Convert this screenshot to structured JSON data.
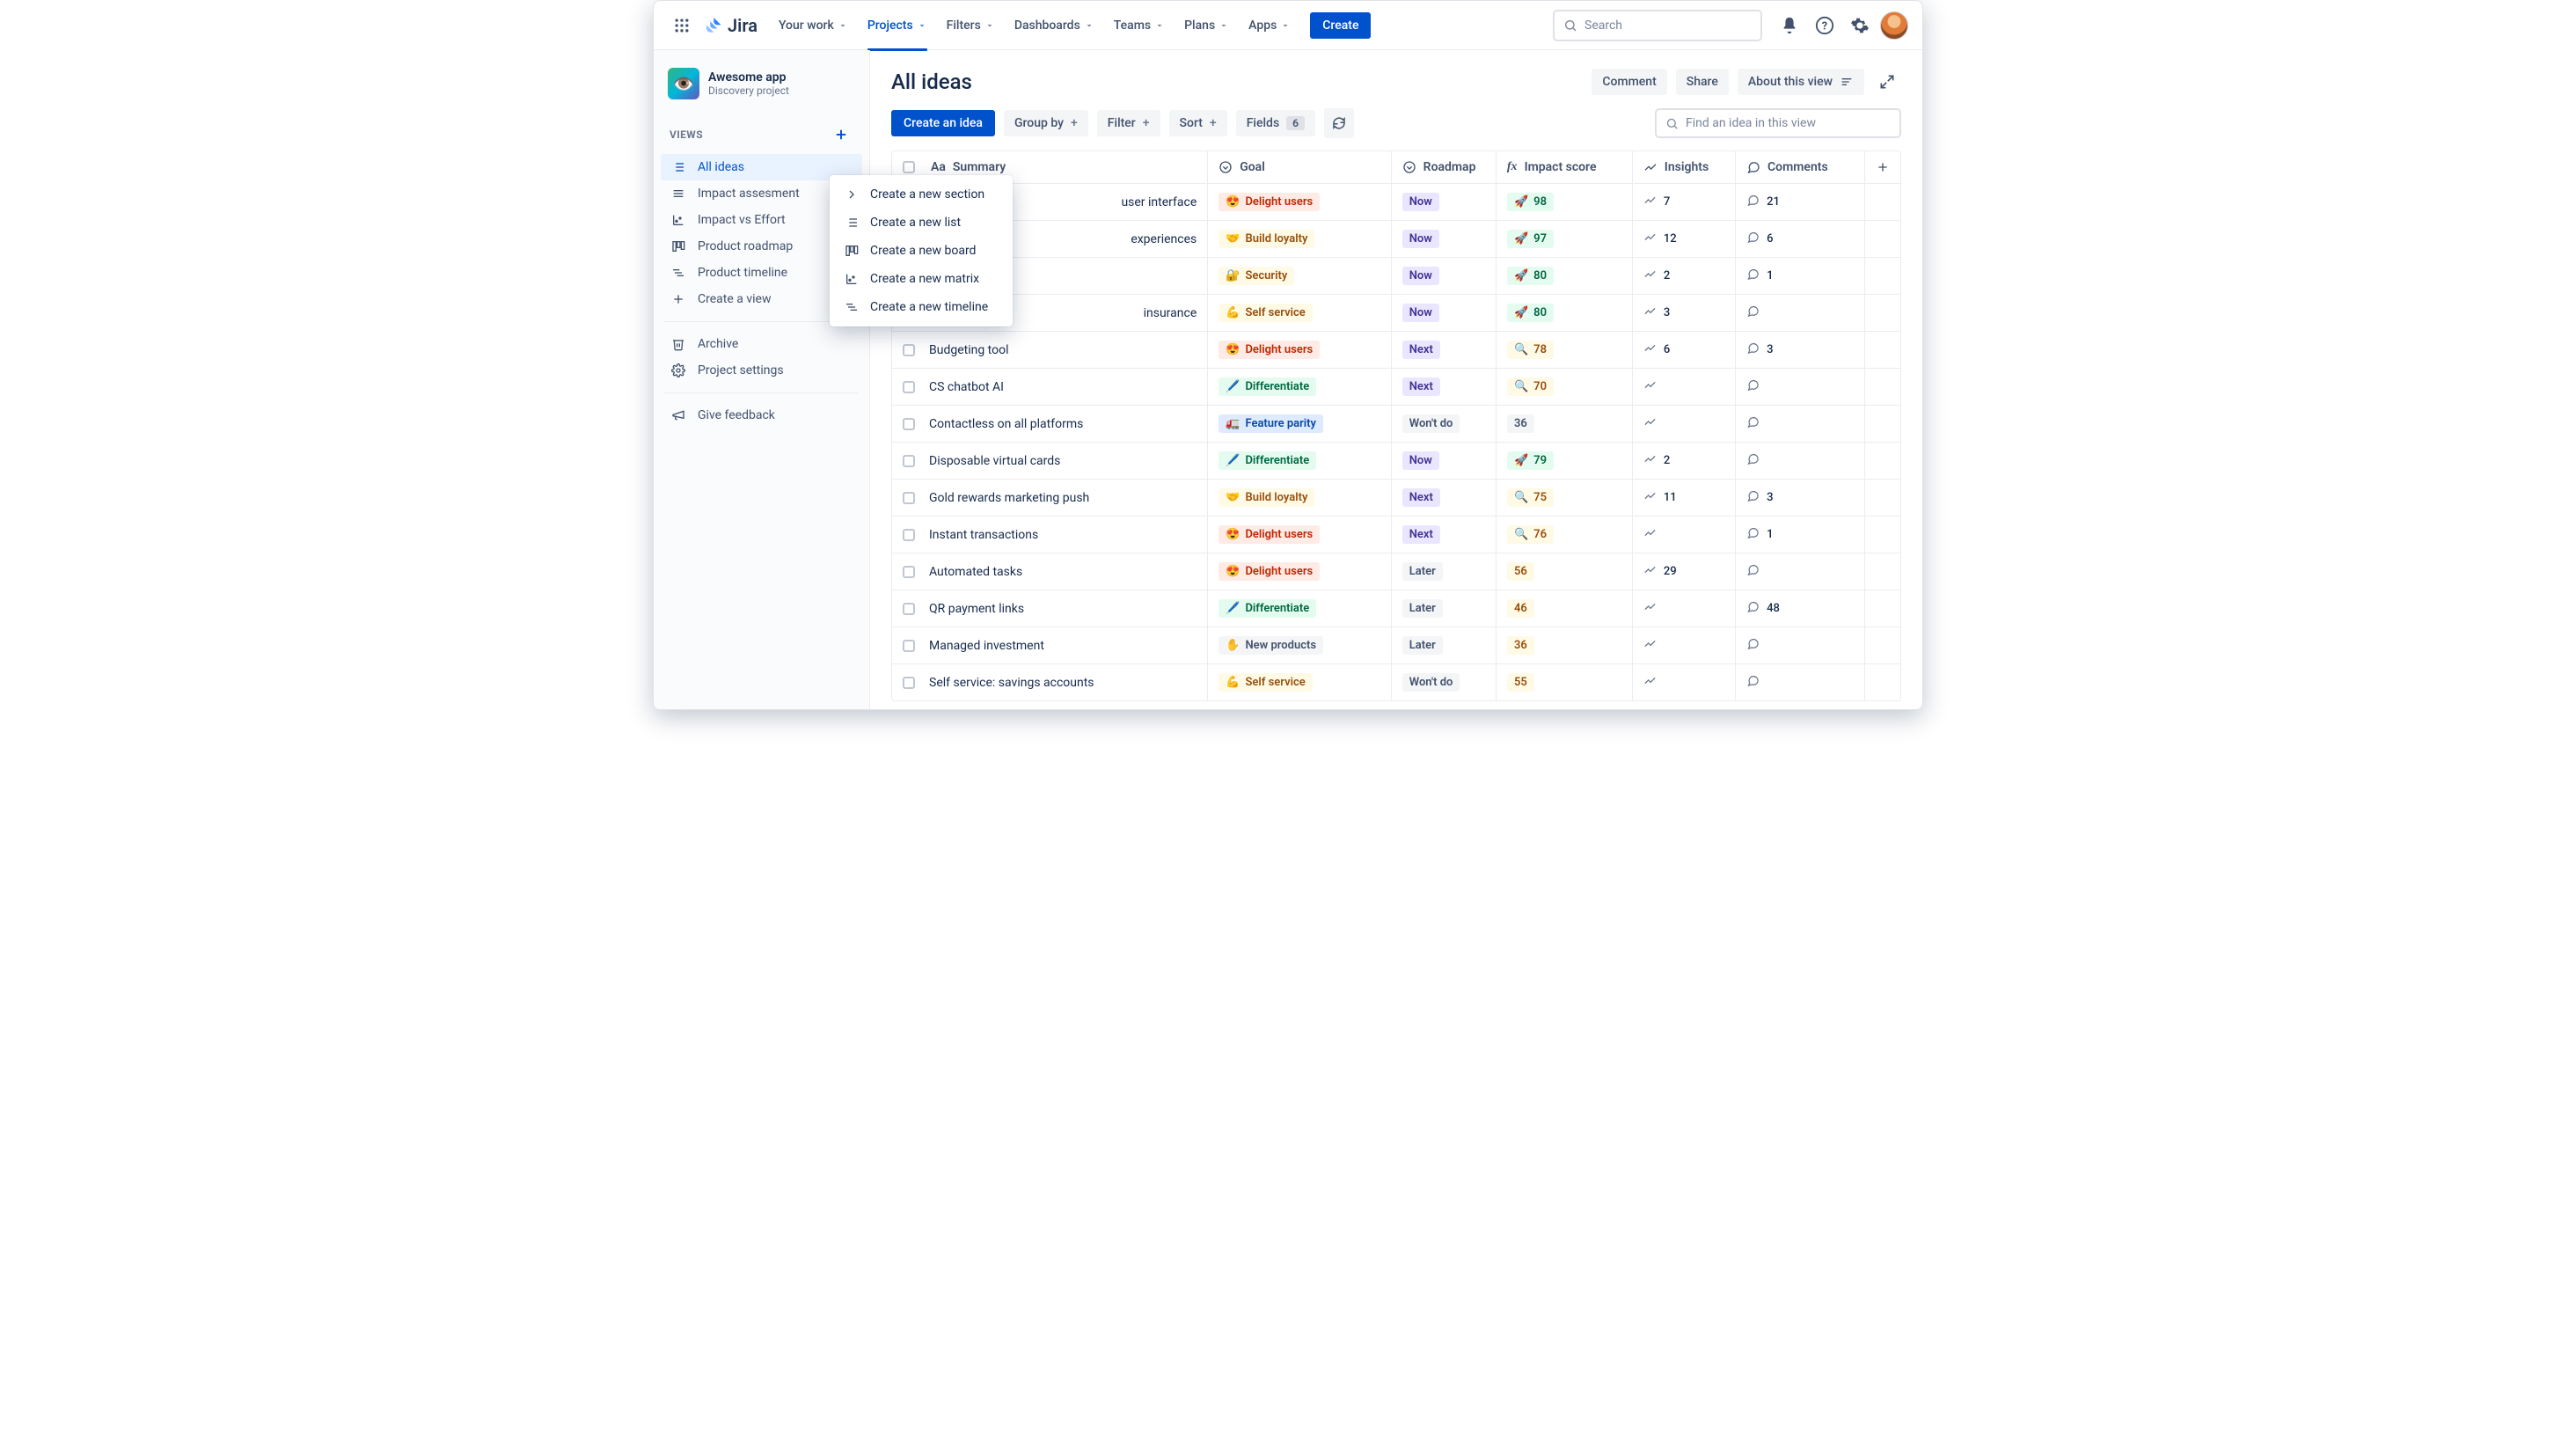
{
  "topnav": {
    "logo": "Jira",
    "items": [
      "Your work",
      "Projects",
      "Filters",
      "Dashboards",
      "Teams",
      "Plans",
      "Apps"
    ],
    "selected_index": 1,
    "create": "Create",
    "search_placeholder": "Search"
  },
  "project": {
    "name": "Awesome app",
    "subtitle": "Discovery project"
  },
  "sidebar": {
    "views_label": "VIEWS",
    "items": [
      {
        "label": "All ideas",
        "icon": "list"
      },
      {
        "label": "Impact assesment",
        "icon": "list2"
      },
      {
        "label": "Impact vs Effort",
        "icon": "matrix"
      },
      {
        "label": "Product roadmap",
        "icon": "board"
      },
      {
        "label": "Product timeline",
        "icon": "timeline"
      }
    ],
    "create_view": "Create a view",
    "archive": "Archive",
    "settings": "Project settings",
    "feedback": "Give feedback"
  },
  "context_menu": [
    {
      "label": "Create a new section",
      "icon": "chevron"
    },
    {
      "label": "Create a new list",
      "icon": "list"
    },
    {
      "label": "Create a new board",
      "icon": "board"
    },
    {
      "label": "Create a new matrix",
      "icon": "matrix"
    },
    {
      "label": "Create a new timeline",
      "icon": "timeline"
    }
  ],
  "page": {
    "title": "All ideas",
    "actions": {
      "comment": "Comment",
      "share": "Share",
      "about": "About this view"
    }
  },
  "toolbar": {
    "create_idea": "Create an idea",
    "group_by": "Group by",
    "filter": "Filter",
    "sort": "Sort",
    "fields": "Fields",
    "fields_count": "6",
    "find_placeholder": "Find an idea in this view"
  },
  "columns": {
    "summary": "Summary",
    "goal": "Goal",
    "roadmap": "Roadmap",
    "impact": "Impact score",
    "insights": "Insights",
    "comments": "Comments"
  },
  "goal_styles": {
    "Delight users": {
      "cls": "goal-delight",
      "emoji": "😍"
    },
    "Build loyalty": {
      "cls": "goal-loyalty",
      "emoji": "🤝"
    },
    "Security": {
      "cls": "goal-security",
      "emoji": "🔐"
    },
    "Self service": {
      "cls": "goal-selfservice",
      "emoji": "💪"
    },
    "Differentiate": {
      "cls": "goal-differentiate",
      "emoji": "🖊️"
    },
    "Feature parity": {
      "cls": "goal-parity",
      "emoji": "🚛"
    },
    "New products": {
      "cls": "goal-newproducts",
      "emoji": "✋"
    }
  },
  "roadmap_styles": {
    "Now": "roadmap-now",
    "Next": "roadmap-next",
    "Later": "roadmap-later",
    "Won't do": "roadmap-wont"
  },
  "rows": [
    {
      "summary": "user interface",
      "summary_partial": true,
      "goal": "Delight users",
      "roadmap": "Now",
      "impact": 98,
      "impact_cls": "impact-green",
      "impact_emoji": "🚀",
      "insights": 7,
      "comments": 21
    },
    {
      "summary": "experiences",
      "summary_partial": true,
      "goal": "Build loyalty",
      "roadmap": "Now",
      "impact": 97,
      "impact_cls": "impact-green",
      "impact_emoji": "🚀",
      "insights": 12,
      "comments": 6
    },
    {
      "summary": "",
      "summary_partial": true,
      "goal": "Security",
      "roadmap": "Now",
      "impact": 80,
      "impact_cls": "impact-green",
      "impact_emoji": "🚀",
      "insights": 2,
      "comments": 1
    },
    {
      "summary": "insurance",
      "summary_partial": true,
      "goal": "Self service",
      "roadmap": "Now",
      "impact": 80,
      "impact_cls": "impact-green",
      "impact_emoji": "🚀",
      "insights": 3,
      "comments": null
    },
    {
      "summary": "Budgeting tool",
      "goal": "Delight users",
      "roadmap": "Next",
      "impact": 78,
      "impact_cls": "impact-yellow",
      "impact_emoji": "🔍",
      "insights": 6,
      "comments": 3
    },
    {
      "summary": "CS chatbot AI",
      "goal": "Differentiate",
      "roadmap": "Next",
      "impact": 70,
      "impact_cls": "impact-yellow",
      "impact_emoji": "🔍",
      "insights": null,
      "comments": null
    },
    {
      "summary": "Contactless on all platforms",
      "goal": "Feature parity",
      "roadmap": "Won't do",
      "impact": 36,
      "impact_cls": "impact-grey",
      "impact_emoji": "",
      "insights": null,
      "comments": null
    },
    {
      "summary": "Disposable virtual cards",
      "goal": "Differentiate",
      "roadmap": "Now",
      "impact": 79,
      "impact_cls": "impact-green",
      "impact_emoji": "🚀",
      "insights": 2,
      "comments": null
    },
    {
      "summary": "Gold rewards marketing push",
      "goal": "Build loyalty",
      "roadmap": "Next",
      "impact": 75,
      "impact_cls": "impact-yellow",
      "impact_emoji": "🔍",
      "insights": 11,
      "comments": 3
    },
    {
      "summary": "Instant transactions",
      "goal": "Delight users",
      "roadmap": "Next",
      "impact": 76,
      "impact_cls": "impact-yellow",
      "impact_emoji": "🔍",
      "insights": null,
      "comments": 1
    },
    {
      "summary": "Automated tasks",
      "goal": "Delight users",
      "roadmap": "Later",
      "impact": 56,
      "impact_cls": "impact-yellow",
      "impact_emoji": "",
      "insights": 29,
      "comments": null
    },
    {
      "summary": "QR payment links",
      "goal": "Differentiate",
      "roadmap": "Later",
      "impact": 46,
      "impact_cls": "impact-yellow",
      "impact_emoji": "",
      "insights": null,
      "comments": 48
    },
    {
      "summary": "Managed investment",
      "goal": "New products",
      "roadmap": "Later",
      "impact": 36,
      "impact_cls": "impact-yellow",
      "impact_emoji": "",
      "insights": null,
      "comments": null
    },
    {
      "summary": "Self service: savings accounts",
      "goal": "Self service",
      "roadmap": "Won't do",
      "impact": 55,
      "impact_cls": "impact-yellow",
      "impact_emoji": "",
      "insights": null,
      "comments": null
    }
  ]
}
